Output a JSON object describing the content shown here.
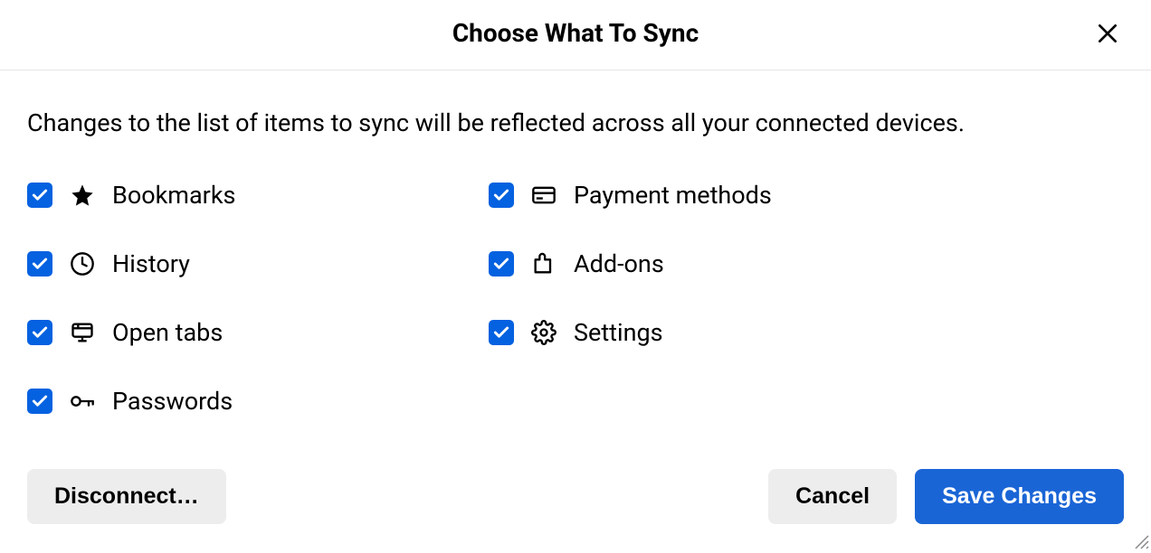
{
  "dialog": {
    "title": "Choose What To Sync",
    "description": "Changes to the list of items to sync will be reflected across all your connected devices."
  },
  "items": {
    "bookmarks": {
      "label": "Bookmarks",
      "checked": true
    },
    "history": {
      "label": "History",
      "checked": true
    },
    "open_tabs": {
      "label": "Open tabs",
      "checked": true
    },
    "passwords": {
      "label": "Passwords",
      "checked": true
    },
    "payment_methods": {
      "label": "Payment methods",
      "checked": true
    },
    "addons": {
      "label": "Add-ons",
      "checked": true
    },
    "settings": {
      "label": "Settings",
      "checked": true
    }
  },
  "buttons": {
    "disconnect": "Disconnect…",
    "cancel": "Cancel",
    "save": "Save Changes"
  }
}
